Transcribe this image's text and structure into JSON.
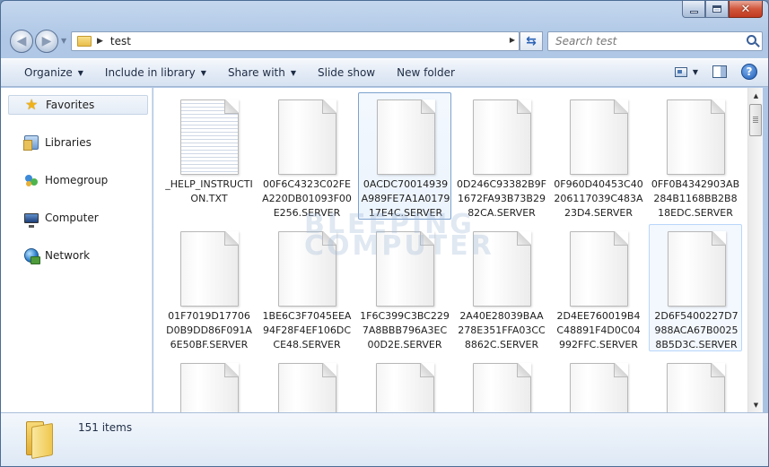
{
  "address": {
    "path": "test"
  },
  "search": {
    "placeholder": "Search test"
  },
  "toolbar": {
    "organize": "Organize",
    "include": "Include in library",
    "share": "Share with",
    "slideshow": "Slide show",
    "newfolder": "New folder"
  },
  "nav": {
    "favorites": "Favorites",
    "libraries": "Libraries",
    "homegroup": "Homegroup",
    "computer": "Computer",
    "network": "Network"
  },
  "files": [
    {
      "name": "_HELP_INSTRUCTION.TXT"
    },
    {
      "name": "00F6C4323C02FEA220DB01093F00E256.SERVER"
    },
    {
      "name": "0ACDC70014939A989FE7A1A017917E4C.SERVER"
    },
    {
      "name": "0D246C93382B9F1672FA93B73B2982CA.SERVER"
    },
    {
      "name": "0F960D40453C40206117039C483A23D4.SERVER"
    },
    {
      "name": "0FF0B4342903AB284B1168BB2B818EDC.SERVER"
    },
    {
      "name": "01F7019D17706D0B9DD86F091A6E50BF.SERVER"
    },
    {
      "name": "1BE6C3F7045EEA94F28F4EF106DCCE48.SERVER"
    },
    {
      "name": "1F6C399C3BC2297A8BBB796A3EC00D2E.SERVER"
    },
    {
      "name": "2A40E28039BAA278E351FFA03CC8862C.SERVER"
    },
    {
      "name": "2D4EE760019B4C48891F4D0C04992FFC.SERVER"
    },
    {
      "name": "2D6F5400227D7988ACA67B00258B5D3C.SERVER"
    }
  ],
  "watermark": {
    "line1": "BLEEPING",
    "line2": "COMPUTER"
  },
  "status": {
    "count": "151 items"
  }
}
